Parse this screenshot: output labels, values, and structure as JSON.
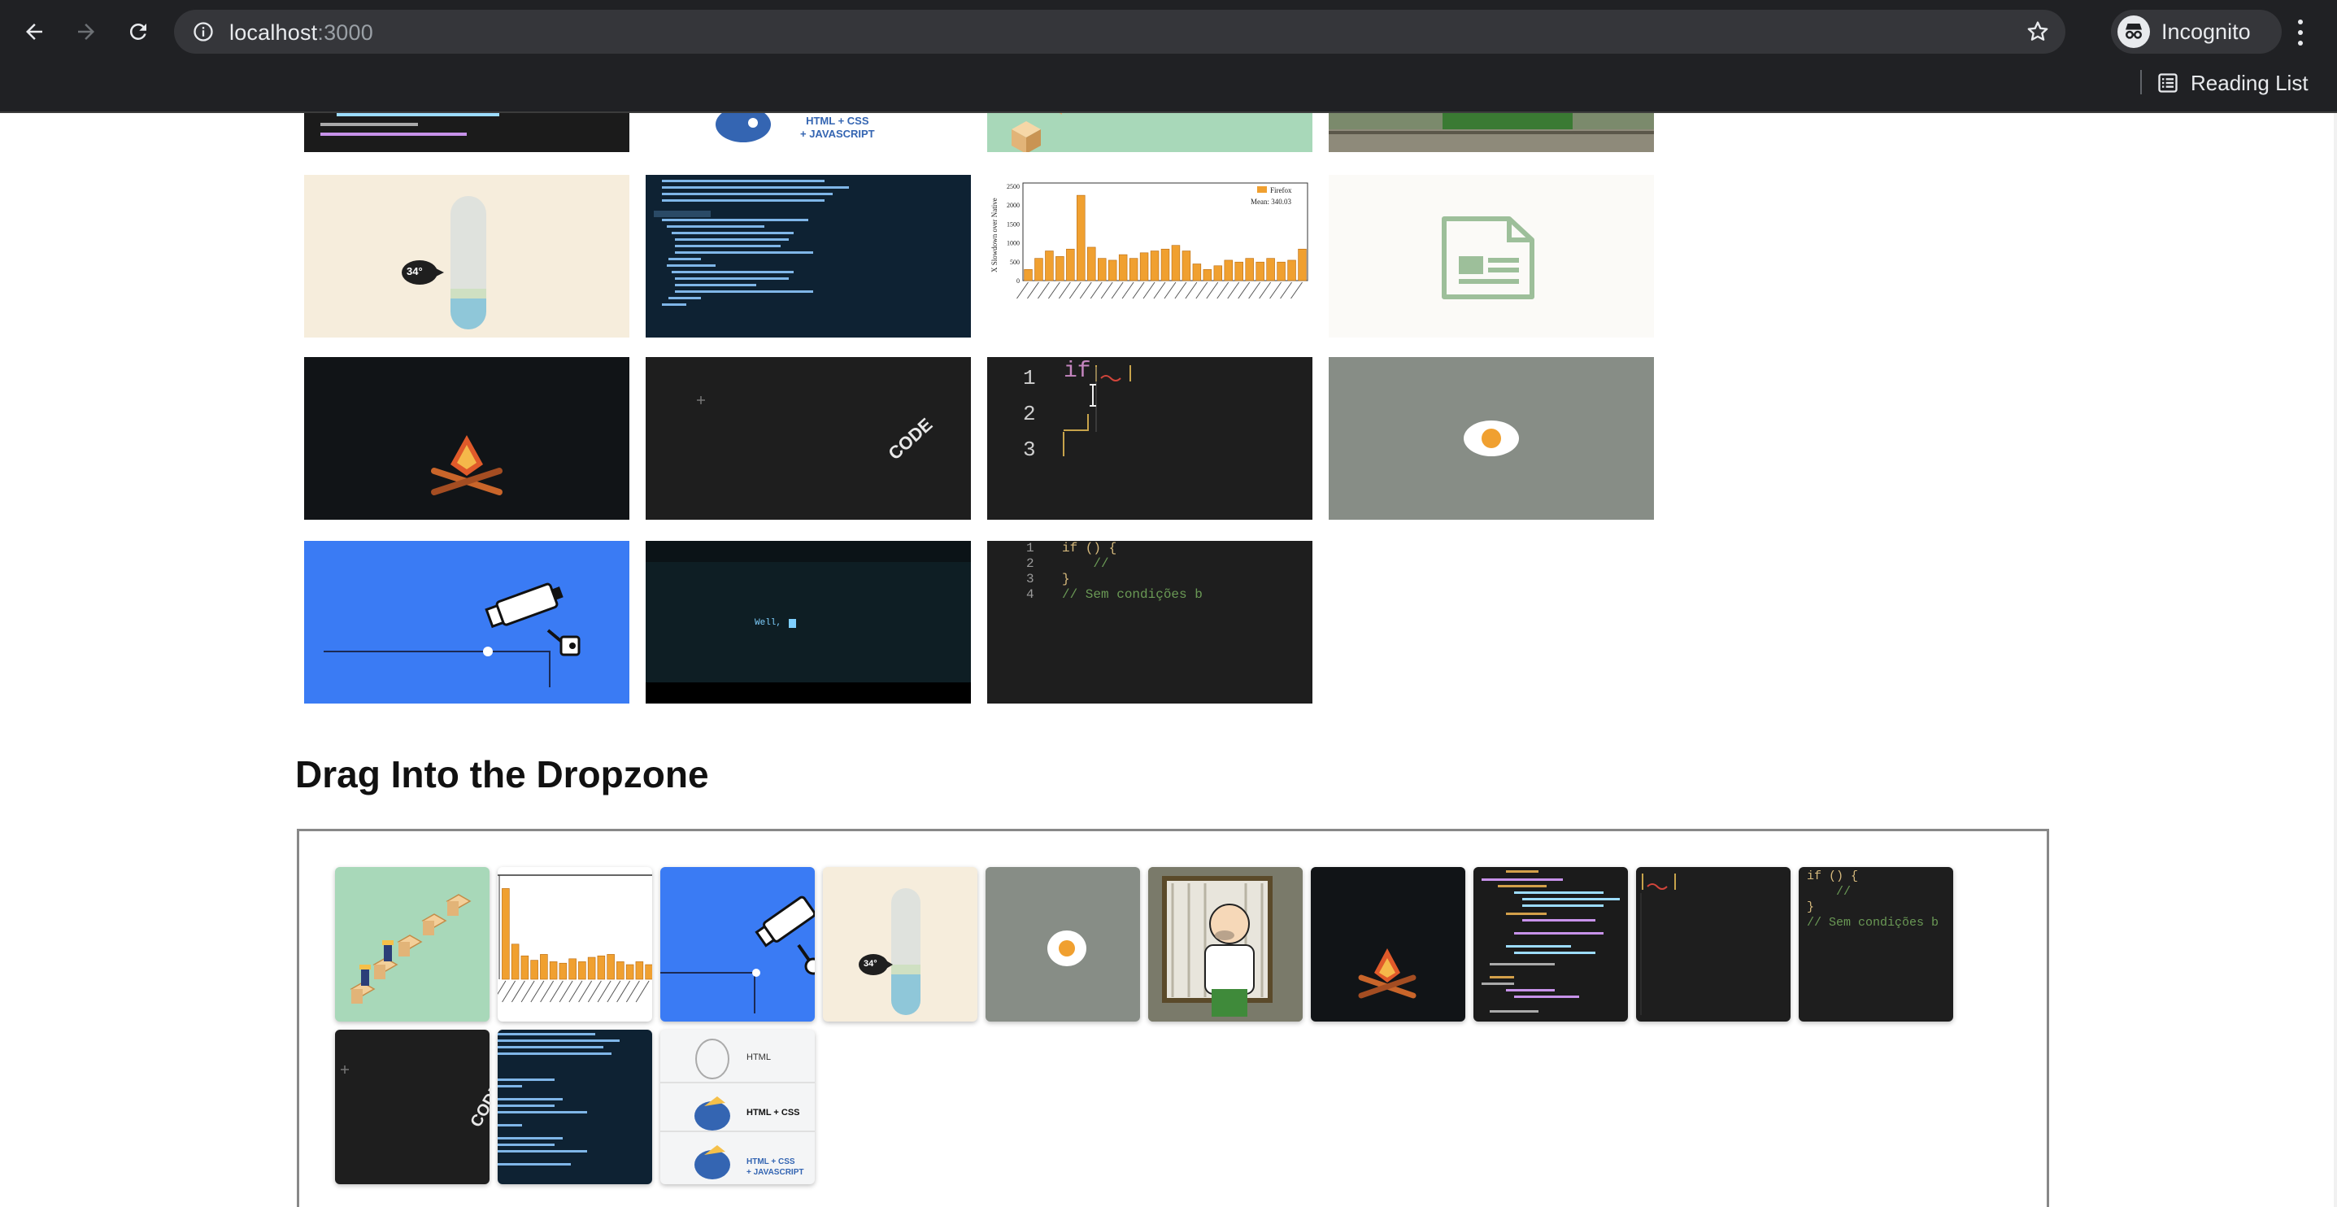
{
  "browser": {
    "url_host": "localhost",
    "url_port": ":3000",
    "profile_label": "Incognito",
    "reading_list_label": "Reading List"
  },
  "section": {
    "title": "Drag Into the Dropzone"
  },
  "tiles": {
    "html_css_js_text": "HTML + CSS\n+ JAVASCRIPT",
    "thermo_temp": "34°",
    "chart_legend": "Firefox",
    "chart_mean": "Mean: 340.03",
    "chart_ylabel": "X Slowdown over Native",
    "chart_yticks": [
      "2500",
      "2000",
      "1500",
      "1000",
      "500",
      "0"
    ],
    "code_word": "CODE",
    "terminal_text": "Well,",
    "code_if": "if",
    "code_lines": [
      "if () {",
      "    //",
      "}",
      "// Sem condições b"
    ],
    "code_line_numbers": [
      "1",
      "2",
      "3",
      "4"
    ],
    "editor_line_numbers": [
      "1",
      "2",
      "3"
    ],
    "html_stack": [
      "HTML",
      "HTML + CSS",
      "HTML + CSS\n+ JAVASCRIPT"
    ]
  },
  "colors": {
    "chrome_bg": "#202124",
    "omnibox_bg": "#35363a",
    "chrome_text": "#e8eaed",
    "accent_blue": "#3a7bf4",
    "mint": "#a8d8b9",
    "cream": "#f6eddc",
    "dark_code": "#1e1e1e",
    "navy_code": "#0e2233",
    "grey_egg": "#878d86",
    "orange": "#f0a030"
  }
}
